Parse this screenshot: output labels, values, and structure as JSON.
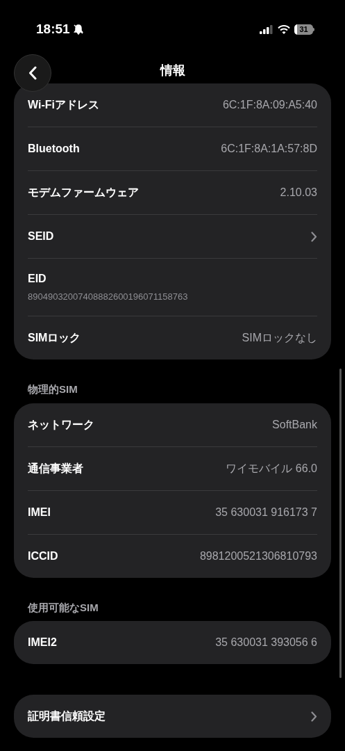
{
  "status_bar": {
    "time": "18:51",
    "battery": "31"
  },
  "header": {
    "title": "情報"
  },
  "sections": [
    {
      "rows": [
        {
          "kind": "value",
          "label": "Wi-Fiアドレス",
          "value": "6C:1F:8A:09:A5:40"
        },
        {
          "kind": "value",
          "label": "Bluetooth",
          "value": "6C:1F:8A:1A:57:8D"
        },
        {
          "kind": "value",
          "label": "モデムファームウェア",
          "value": "2.10.03"
        },
        {
          "kind": "chevron",
          "label": "SEID"
        },
        {
          "kind": "stacked",
          "label": "EID",
          "value": "89049032007408882600196071158763"
        },
        {
          "kind": "value",
          "label": "SIMロック",
          "value": "SIMロックなし"
        }
      ]
    },
    {
      "title": "物理的SIM",
      "rows": [
        {
          "kind": "value",
          "label": "ネットワーク",
          "value": "SoftBank"
        },
        {
          "kind": "value",
          "label": "通信事業者",
          "value": "ワイモバイル 66.0"
        },
        {
          "kind": "value",
          "label": "IMEI",
          "value": "35 630031 916173 7"
        },
        {
          "kind": "value",
          "label": "ICCID",
          "value": "8981200521306810793"
        }
      ]
    },
    {
      "title": "使用可能なSIM",
      "rows": [
        {
          "kind": "value",
          "label": "IMEI2",
          "value": "35 630031 393056 6"
        }
      ]
    },
    {
      "rows": [
        {
          "kind": "chevron",
          "label": "証明書信頼設定"
        }
      ]
    }
  ]
}
